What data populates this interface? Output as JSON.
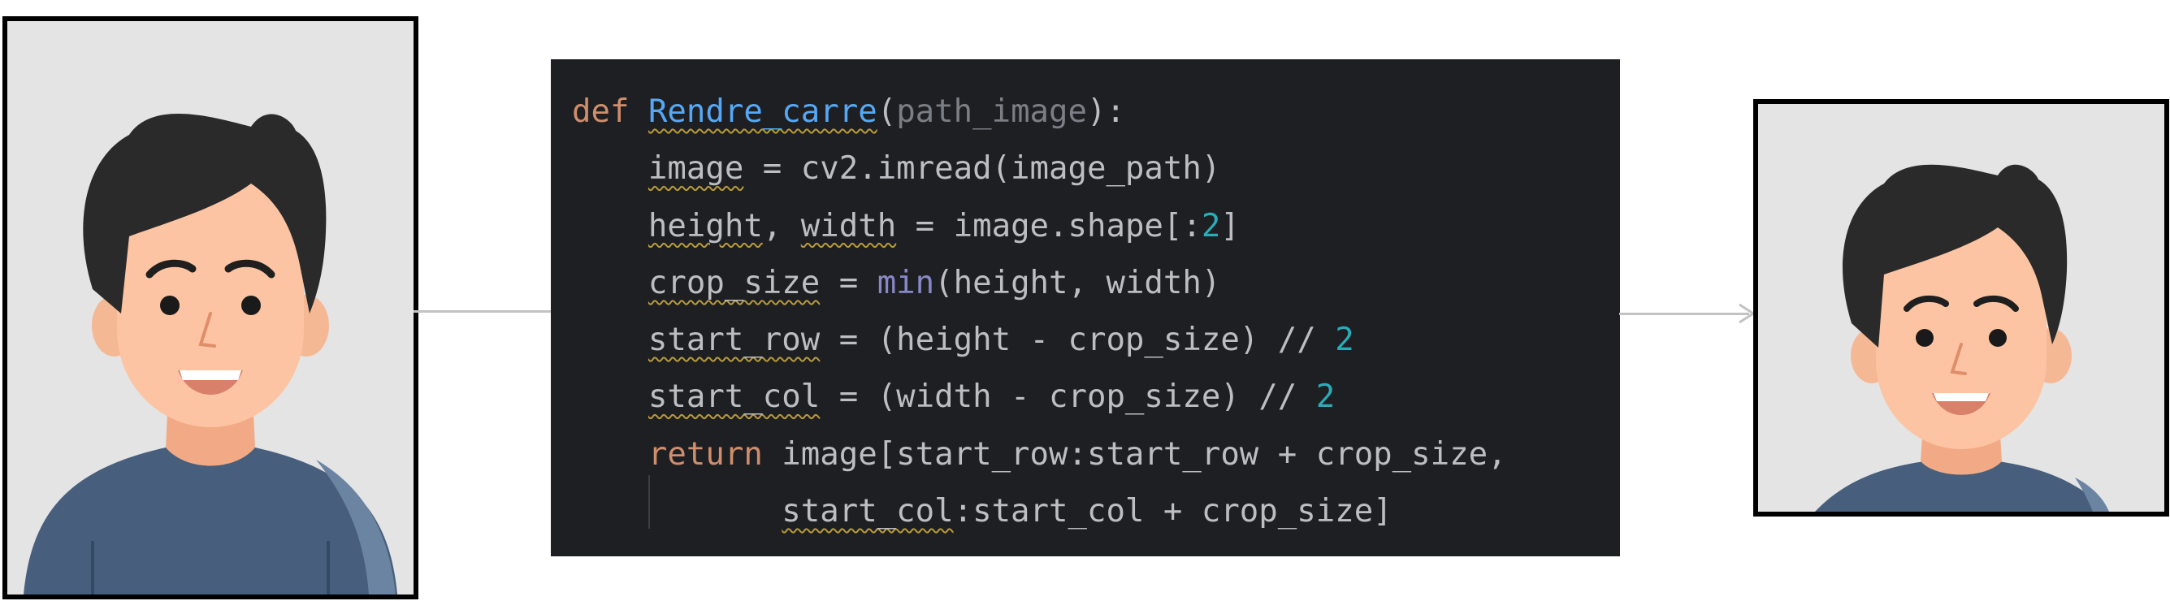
{
  "diagram": {
    "input_image": {
      "icon": "person-portrait-icon",
      "shape": "rectangular"
    },
    "output_image": {
      "icon": "person-portrait-icon",
      "shape": "square"
    },
    "colors": {
      "background": "#ffffff",
      "code_background": "#1e1f22",
      "portrait_background": "#e4e4e4",
      "frame": "#000000",
      "connector": "#c2c2c2",
      "keyword": "#cf8e6d",
      "function_name": "#56a8f5",
      "parameter": "#7a7e85",
      "builtin": "#8888c6",
      "number": "#2aacb8",
      "text": "#bcbec4"
    }
  },
  "code": {
    "lines": [
      [
        {
          "t": "def",
          "c": "kw"
        },
        {
          "t": " ",
          "c": "plain"
        },
        {
          "t": "Rendre_carre",
          "c": "fn",
          "u": true
        },
        {
          "t": "(",
          "c": "plain"
        },
        {
          "t": "path_image",
          "c": "param"
        },
        {
          "t": "):",
          "c": "plain"
        }
      ],
      [
        {
          "t": "    ",
          "c": "plain"
        },
        {
          "t": "image",
          "c": "plain",
          "u": true
        },
        {
          "t": " = cv2.imread(image_path)",
          "c": "plain"
        }
      ],
      [
        {
          "t": "    ",
          "c": "plain"
        },
        {
          "t": "height",
          "c": "plain",
          "u": true
        },
        {
          "t": ", ",
          "c": "plain"
        },
        {
          "t": "width",
          "c": "plain",
          "u": true
        },
        {
          "t": " = image.shape[:",
          "c": "plain"
        },
        {
          "t": "2",
          "c": "num"
        },
        {
          "t": "]",
          "c": "plain"
        }
      ],
      [
        {
          "t": "    ",
          "c": "plain"
        },
        {
          "t": "crop_size",
          "c": "plain",
          "u": true
        },
        {
          "t": " = ",
          "c": "plain"
        },
        {
          "t": "min",
          "c": "builtin"
        },
        {
          "t": "(height, width)",
          "c": "plain"
        }
      ],
      [
        {
          "t": "    ",
          "c": "plain"
        },
        {
          "t": "start_row",
          "c": "plain",
          "u": true
        },
        {
          "t": " = (height - crop_size) // ",
          "c": "plain"
        },
        {
          "t": "2",
          "c": "num"
        }
      ],
      [
        {
          "t": "    ",
          "c": "plain"
        },
        {
          "t": "start_col",
          "c": "plain",
          "u": true
        },
        {
          "t": " = (width - crop_size) // ",
          "c": "plain"
        },
        {
          "t": "2",
          "c": "num"
        }
      ],
      [
        {
          "t": "    ",
          "c": "plain"
        },
        {
          "t": "return",
          "c": "kw"
        },
        {
          "t": " image[start_row:start_row + crop_size,",
          "c": "plain"
        }
      ],
      [
        {
          "t": "           ",
          "c": "plain"
        },
        {
          "t": "start_col",
          "c": "plain",
          "u": true
        },
        {
          "t": ":start_col + crop_size]",
          "c": "plain"
        }
      ]
    ]
  }
}
